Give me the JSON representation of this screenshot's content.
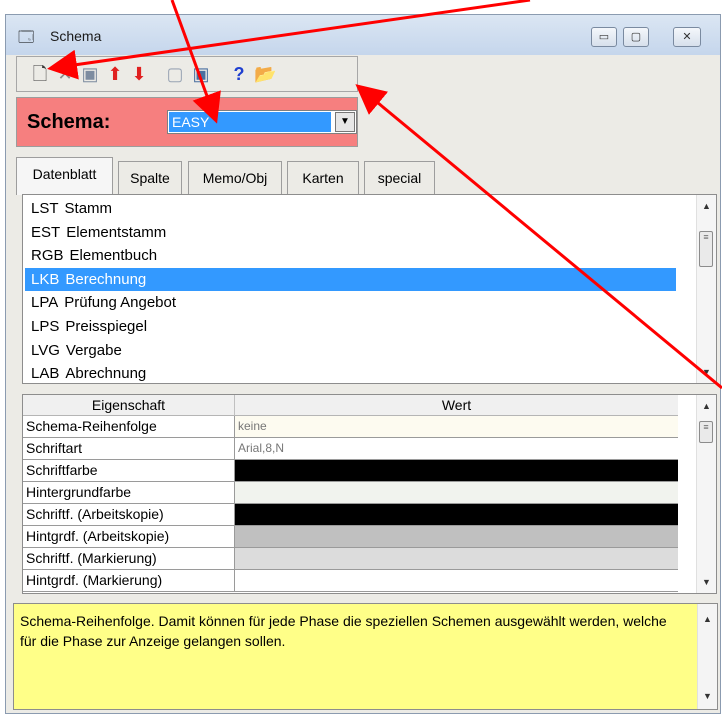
{
  "window": {
    "title": "Schema",
    "icon": "schema-app-icon"
  },
  "title_buttons": [
    {
      "name": "minimize-button",
      "glyph": "▭"
    },
    {
      "name": "maximize-button",
      "glyph": "▢"
    },
    {
      "name": "close-button",
      "glyph": "✕"
    }
  ],
  "toolbar": {
    "icons": [
      {
        "name": "new-document-icon",
        "glyph": "🗋",
        "color": "#3a3a3a"
      },
      {
        "name": "delete-icon",
        "glyph": "✕",
        "color": "#8a8a8a"
      },
      {
        "name": "save-icon",
        "glyph": "▣",
        "color": "#7d8ca0"
      },
      {
        "name": "move-up-icon",
        "glyph": "⬆",
        "color": "#e02020"
      },
      {
        "name": "move-down-icon",
        "glyph": "⬇",
        "color": "#e02020"
      },
      {
        "name": "edit-disabled-icon",
        "glyph": "▢",
        "color": "#9aa5b5"
      },
      {
        "name": "preview-icon",
        "glyph": "▣",
        "color": "#4a6fa0"
      },
      {
        "name": "help-icon",
        "glyph": "?",
        "color": "#1f3fd0"
      },
      {
        "name": "open-folder-icon",
        "glyph": "📂",
        "color": "#d8a020"
      }
    ]
  },
  "schema_bar": {
    "label": "Schema:",
    "selected": "EASY",
    "color": "#f67f7f"
  },
  "tabs": [
    "Datenblatt",
    "Spalte",
    "Memo/Obj",
    "Karten",
    "special"
  ],
  "phases": [
    {
      "code": "LST",
      "name": "Stamm"
    },
    {
      "code": "EST",
      "name": "Elementstamm"
    },
    {
      "code": "RGB",
      "name": "Elementbuch"
    },
    {
      "code": "LKB",
      "name": "Berechnung",
      "selected": true
    },
    {
      "code": "LPA",
      "name": "Prüfung Angebot"
    },
    {
      "code": "LPS",
      "name": "Preisspiegel"
    },
    {
      "code": "LVG",
      "name": "Vergabe"
    },
    {
      "code": "LAB",
      "name": "Abrechnung"
    }
  ],
  "properties": {
    "headers": [
      "Eigenschaft",
      "Wert"
    ],
    "rows": [
      {
        "name": "Schema-Reihenfolge",
        "value": "keine",
        "bg": "#fdfbf0"
      },
      {
        "name": "Schriftart",
        "value": "Arial,8,N",
        "bg": "#ffffff"
      },
      {
        "name": "Schriftfarbe",
        "value": "",
        "bg": "#000000"
      },
      {
        "name": "Hintergrundfarbe",
        "value": "",
        "bg": "#f1f3ee"
      },
      {
        "name": "Schriftf. (Arbeitskopie)",
        "value": "",
        "bg": "#000000"
      },
      {
        "name": "Hintgrdf. (Arbeitskopie)",
        "value": "",
        "bg": "#c0c0c0"
      },
      {
        "name": "Schriftf. (Markierung)",
        "value": "",
        "bg": "#dcdcdc"
      },
      {
        "name": "Hintgrdf. (Markierung)",
        "value": "",
        "bg": "#ffffff"
      }
    ]
  },
  "memo": {
    "text": "Schema-Reihenfolge. Damit können für jede Phase die speziellen Schemen ausgewählt werden, welche für die Phase zur Anzeige gelangen sollen.",
    "bg": "#ffff88"
  },
  "annotation_color": "#ff0000"
}
